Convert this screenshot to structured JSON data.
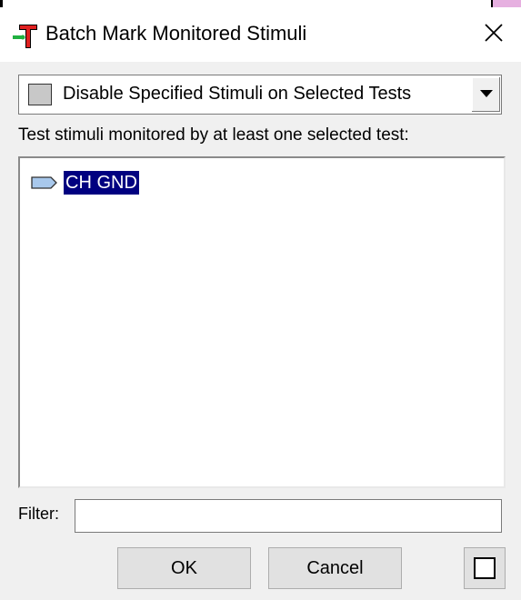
{
  "window": {
    "title": "Batch Mark Monitored Stimuli",
    "app_icon": "tessy-t-icon",
    "close_icon": "close-icon"
  },
  "mode_select": {
    "selected": "Disable Specified Stimuli on Selected Tests",
    "swatch_color": "#c8c8c8"
  },
  "list": {
    "label": "Test stimuli monitored by at least one selected test:",
    "items": [
      {
        "label": "CH GND",
        "icon": "stimulus-tag-icon",
        "selected": true
      }
    ],
    "selection_color": "#000080"
  },
  "filter": {
    "label": "Filter:",
    "value": ""
  },
  "buttons": {
    "ok": "OK",
    "cancel": "Cancel"
  },
  "colors": {
    "accent_red": "#e02020",
    "accent_green": "#20b040",
    "window_bg": "#f0f0f0"
  }
}
